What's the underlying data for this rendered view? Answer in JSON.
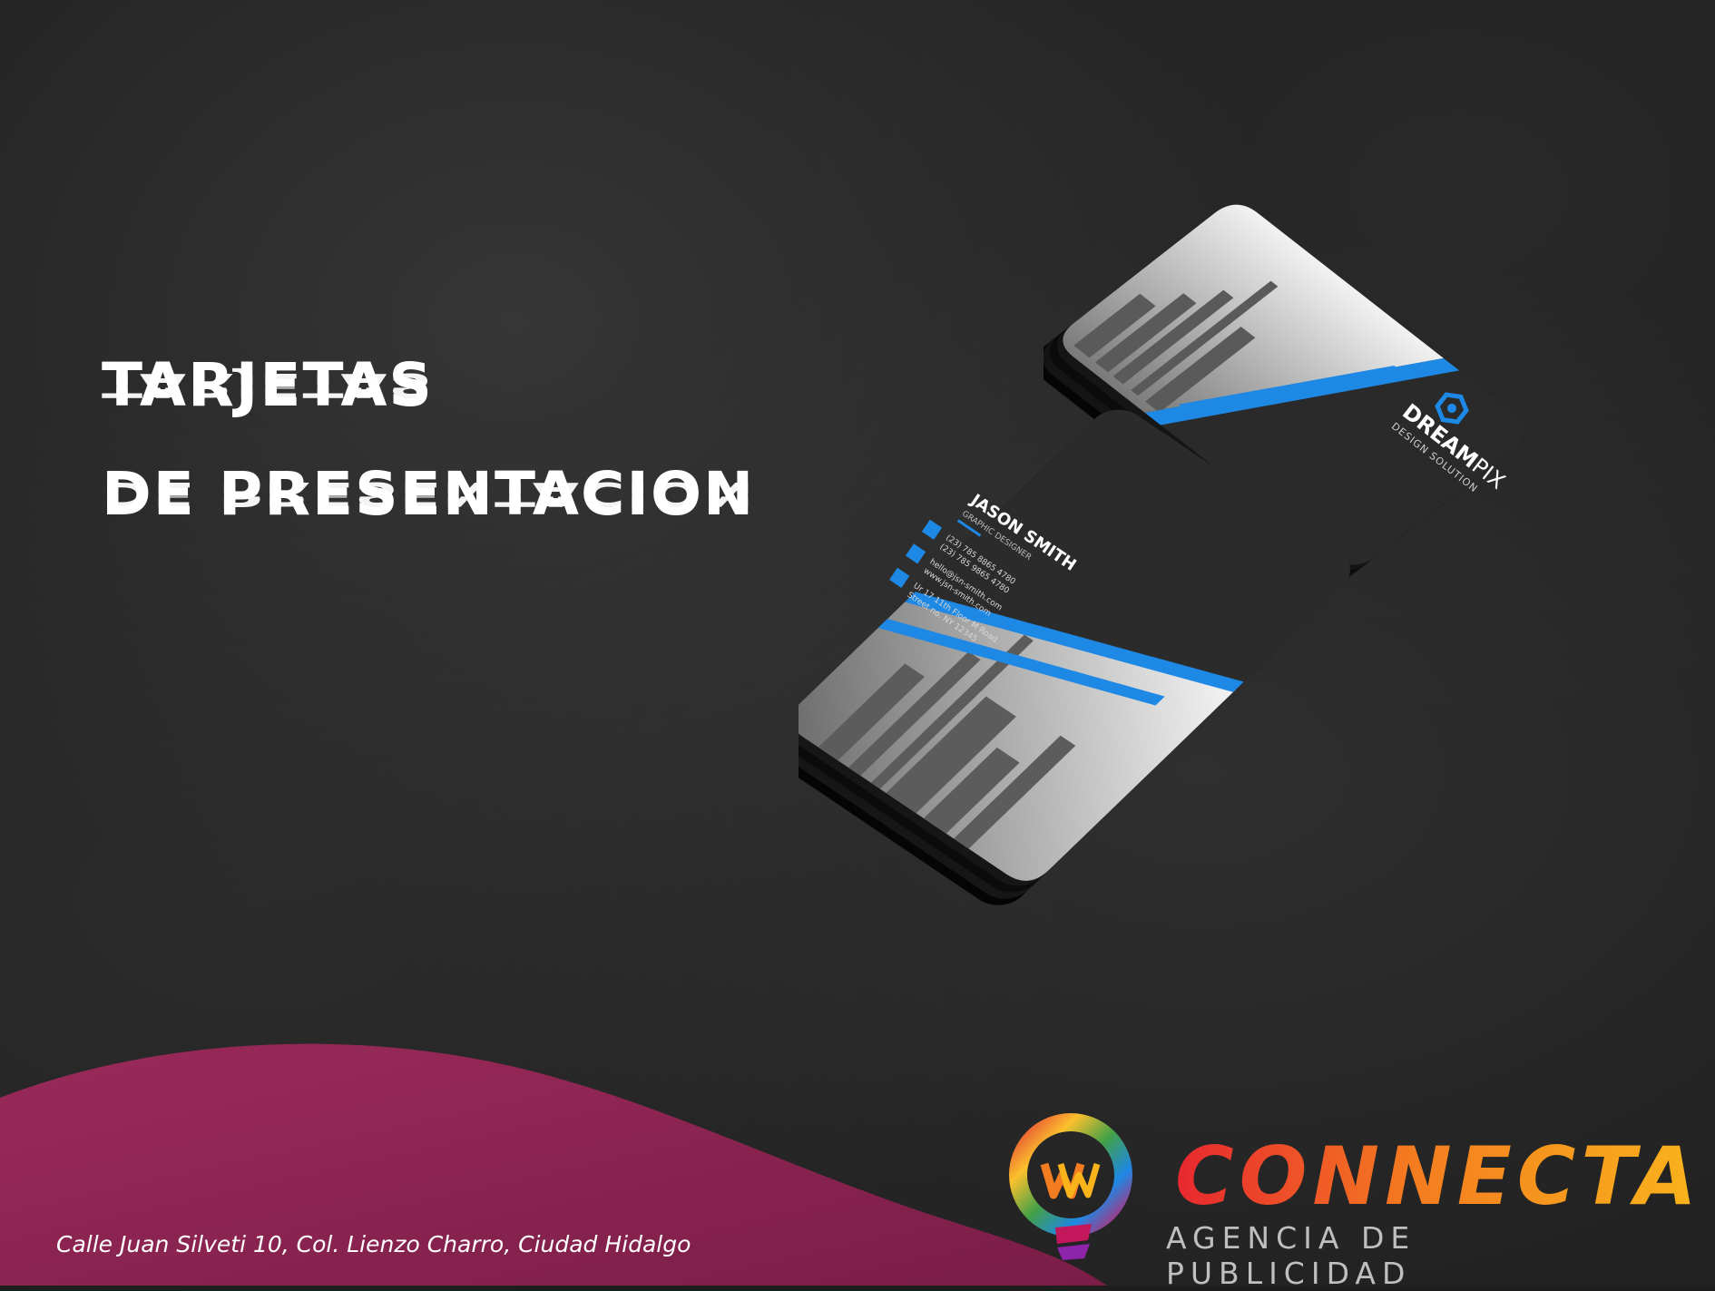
{
  "headline": {
    "line1": "TARJETAS",
    "line2": "DE PRESENTACION"
  },
  "card_front": {
    "name": "JASON SMITH",
    "role": "GRAPHIC DESIGNER",
    "phone1": "(23) 785 8865 4780",
    "phone2": "(23) 785 9865 4780",
    "email": "hello@jsn-smith.com",
    "web": "www.jsn-smith.com",
    "address1": "Ur 17 11th Floor M Road",
    "address2": "Street no. NY 12345"
  },
  "card_back": {
    "brand_bold": "DREAM",
    "brand_light": "PIX",
    "tagline": "DESIGN SOLUTION"
  },
  "footer": {
    "address": "Calle Juan Silveti 10, Col. Lienzo Charro, Ciudad Hidalgo",
    "brand": "CONNECTA",
    "tagline": "AGENCIA DE PUBLICIDAD"
  },
  "colors": {
    "accent_blue": "#1e88e5",
    "wave": "#8a2450",
    "card_dark": "#2b2b2b"
  }
}
